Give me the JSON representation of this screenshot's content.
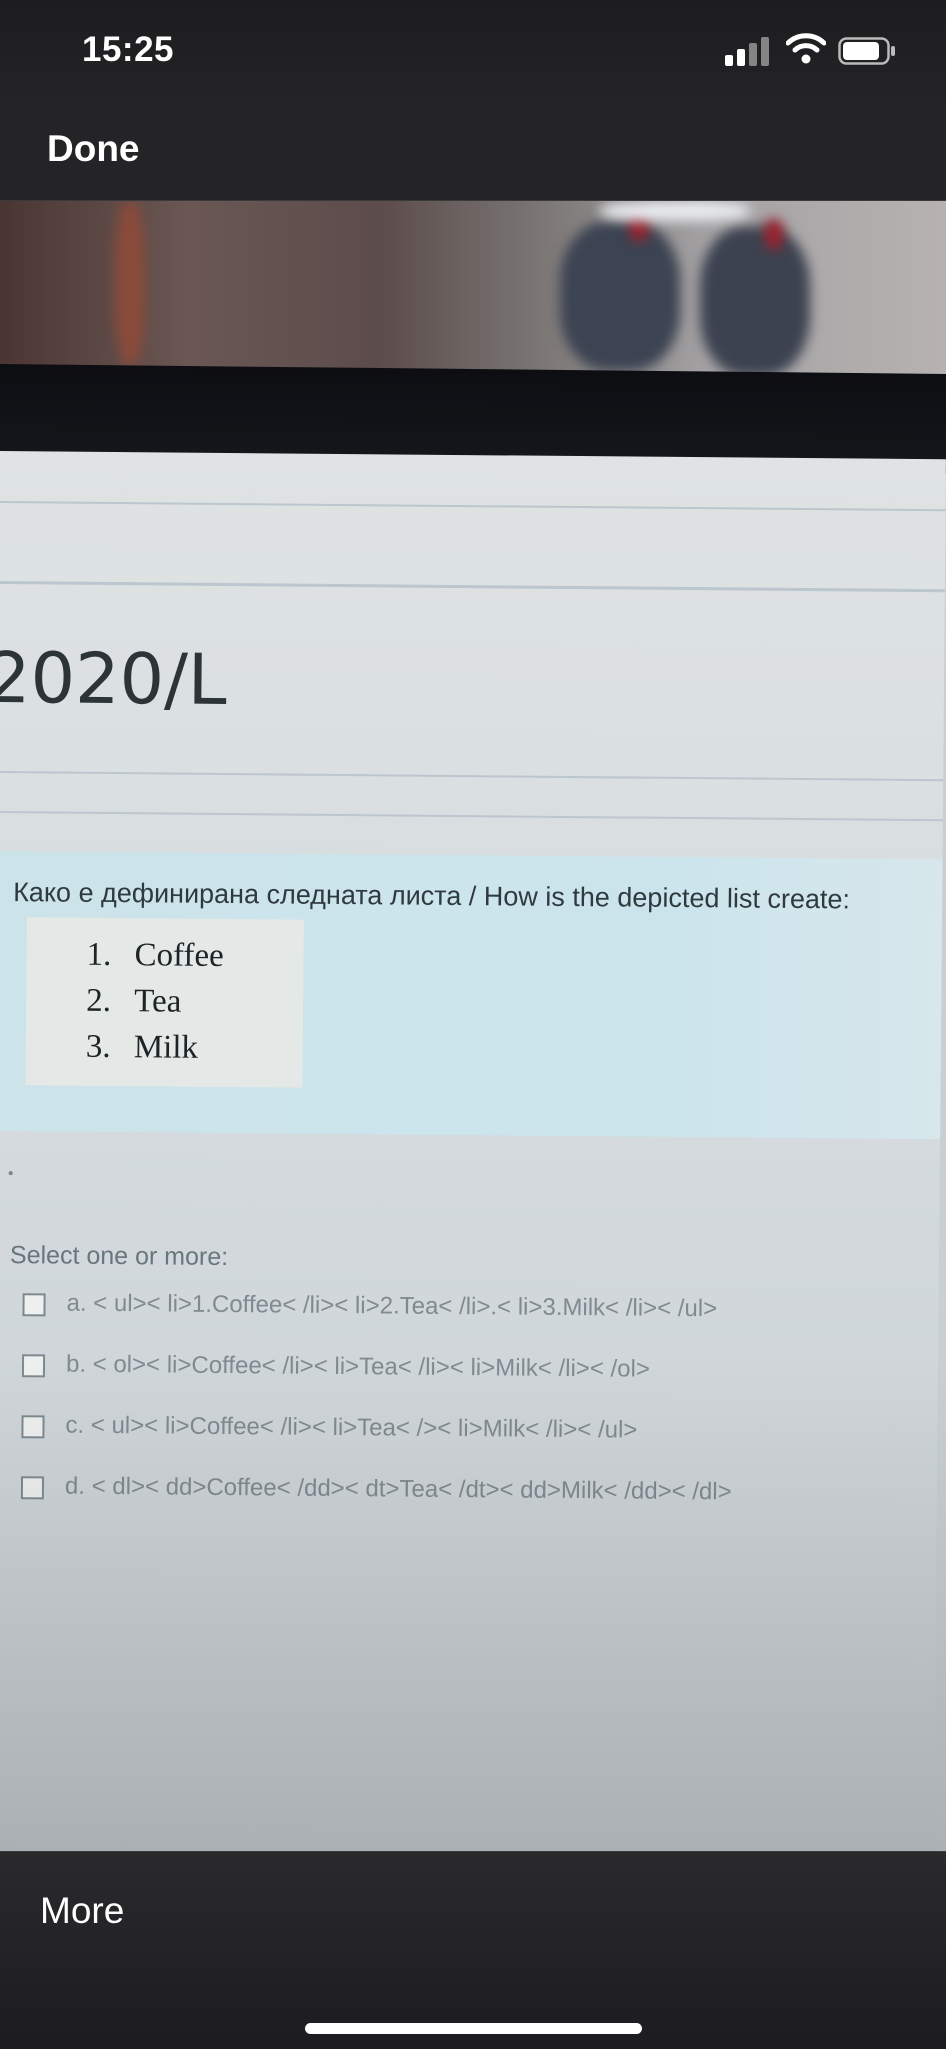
{
  "status_bar": {
    "time": "15:25",
    "icons": [
      "signal-icon",
      "wifi-icon",
      "battery-icon"
    ]
  },
  "nav": {
    "done_label": "Done"
  },
  "photo": {
    "course_code": "2020/L",
    "question": "Како е дефинирана следната листа / How is the depicted list create:",
    "list_items": [
      {
        "num": "1.",
        "text": "Coffee"
      },
      {
        "num": "2.",
        "text": "Tea"
      },
      {
        "num": "3.",
        "text": "Milk"
      }
    ],
    "select_label": "Select one or more:",
    "answers": [
      "a. < ul>< li>1.Coffee< /li>< li>2.Tea< /li>.< li>3.Milk< /li>< /ul>",
      "b. < ol>< li>Coffee< /li>< li>Tea< /li>< li>Milk< /li>< /ol>",
      "c. < ul>< li>Coffee< /li>< li>Tea< />< li>Milk< /li>< /ul>",
      "d. < dl>< dd>Coffee< /dd>< dt>Tea< /dt>< dd>Milk< /dd>< /dl>"
    ]
  },
  "bottom_bar": {
    "more_label": "More"
  },
  "colors": {
    "question_bg": "#cde3ea",
    "screen_bg": "#dfe3e3",
    "chrome_bg": "#1c1c1e"
  }
}
